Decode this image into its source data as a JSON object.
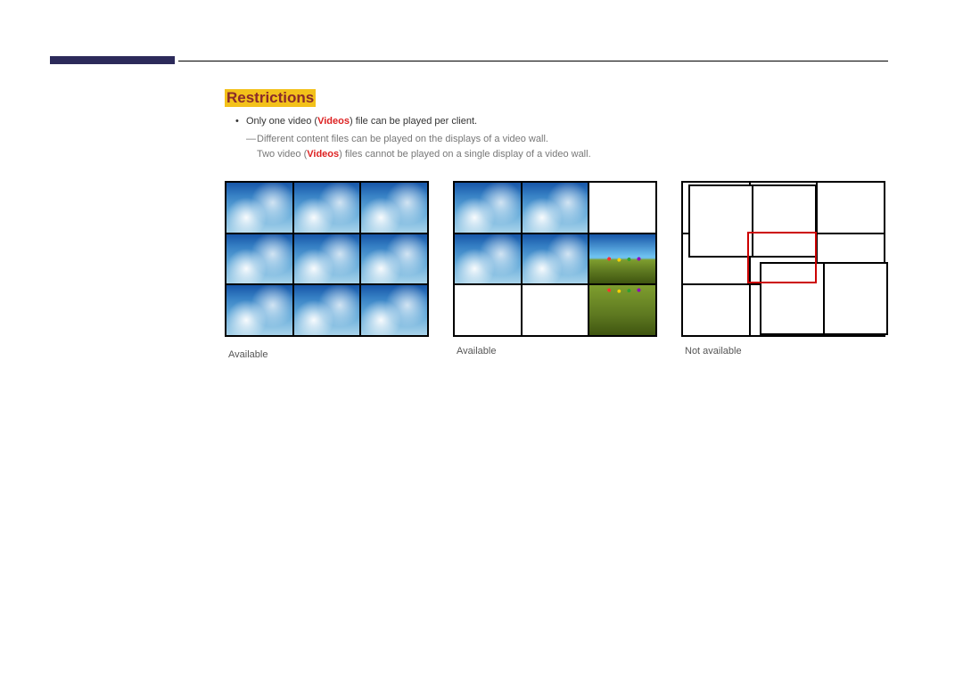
{
  "heading": "Restrictions",
  "bullet": {
    "pre": "Only one video (",
    "hl": "Videos",
    "post": ") file can be played per client."
  },
  "sub1": "Different content files can be played on the displays of a video wall.",
  "sub2": {
    "pre": "Two video (",
    "hl": "Videos",
    "post": ") files cannot be played on a single display of a video wall."
  },
  "captions": {
    "c1": "Available",
    "c2": "Available",
    "c3": "Not available"
  }
}
